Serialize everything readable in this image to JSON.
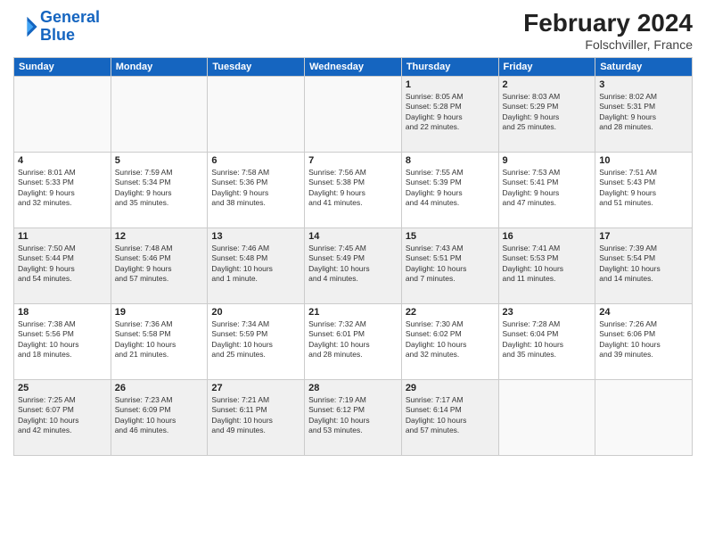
{
  "logo": {
    "line1": "General",
    "line2": "Blue"
  },
  "title": {
    "month_year": "February 2024",
    "location": "Folschviller, France"
  },
  "weekdays": [
    "Sunday",
    "Monday",
    "Tuesday",
    "Wednesday",
    "Thursday",
    "Friday",
    "Saturday"
  ],
  "weeks": [
    [
      {
        "day": "",
        "info": ""
      },
      {
        "day": "",
        "info": ""
      },
      {
        "day": "",
        "info": ""
      },
      {
        "day": "",
        "info": ""
      },
      {
        "day": "1",
        "info": "Sunrise: 8:05 AM\nSunset: 5:28 PM\nDaylight: 9 hours\nand 22 minutes."
      },
      {
        "day": "2",
        "info": "Sunrise: 8:03 AM\nSunset: 5:29 PM\nDaylight: 9 hours\nand 25 minutes."
      },
      {
        "day": "3",
        "info": "Sunrise: 8:02 AM\nSunset: 5:31 PM\nDaylight: 9 hours\nand 28 minutes."
      }
    ],
    [
      {
        "day": "4",
        "info": "Sunrise: 8:01 AM\nSunset: 5:33 PM\nDaylight: 9 hours\nand 32 minutes."
      },
      {
        "day": "5",
        "info": "Sunrise: 7:59 AM\nSunset: 5:34 PM\nDaylight: 9 hours\nand 35 minutes."
      },
      {
        "day": "6",
        "info": "Sunrise: 7:58 AM\nSunset: 5:36 PM\nDaylight: 9 hours\nand 38 minutes."
      },
      {
        "day": "7",
        "info": "Sunrise: 7:56 AM\nSunset: 5:38 PM\nDaylight: 9 hours\nand 41 minutes."
      },
      {
        "day": "8",
        "info": "Sunrise: 7:55 AM\nSunset: 5:39 PM\nDaylight: 9 hours\nand 44 minutes."
      },
      {
        "day": "9",
        "info": "Sunrise: 7:53 AM\nSunset: 5:41 PM\nDaylight: 9 hours\nand 47 minutes."
      },
      {
        "day": "10",
        "info": "Sunrise: 7:51 AM\nSunset: 5:43 PM\nDaylight: 9 hours\nand 51 minutes."
      }
    ],
    [
      {
        "day": "11",
        "info": "Sunrise: 7:50 AM\nSunset: 5:44 PM\nDaylight: 9 hours\nand 54 minutes."
      },
      {
        "day": "12",
        "info": "Sunrise: 7:48 AM\nSunset: 5:46 PM\nDaylight: 9 hours\nand 57 minutes."
      },
      {
        "day": "13",
        "info": "Sunrise: 7:46 AM\nSunset: 5:48 PM\nDaylight: 10 hours\nand 1 minute."
      },
      {
        "day": "14",
        "info": "Sunrise: 7:45 AM\nSunset: 5:49 PM\nDaylight: 10 hours\nand 4 minutes."
      },
      {
        "day": "15",
        "info": "Sunrise: 7:43 AM\nSunset: 5:51 PM\nDaylight: 10 hours\nand 7 minutes."
      },
      {
        "day": "16",
        "info": "Sunrise: 7:41 AM\nSunset: 5:53 PM\nDaylight: 10 hours\nand 11 minutes."
      },
      {
        "day": "17",
        "info": "Sunrise: 7:39 AM\nSunset: 5:54 PM\nDaylight: 10 hours\nand 14 minutes."
      }
    ],
    [
      {
        "day": "18",
        "info": "Sunrise: 7:38 AM\nSunset: 5:56 PM\nDaylight: 10 hours\nand 18 minutes."
      },
      {
        "day": "19",
        "info": "Sunrise: 7:36 AM\nSunset: 5:58 PM\nDaylight: 10 hours\nand 21 minutes."
      },
      {
        "day": "20",
        "info": "Sunrise: 7:34 AM\nSunset: 5:59 PM\nDaylight: 10 hours\nand 25 minutes."
      },
      {
        "day": "21",
        "info": "Sunrise: 7:32 AM\nSunset: 6:01 PM\nDaylight: 10 hours\nand 28 minutes."
      },
      {
        "day": "22",
        "info": "Sunrise: 7:30 AM\nSunset: 6:02 PM\nDaylight: 10 hours\nand 32 minutes."
      },
      {
        "day": "23",
        "info": "Sunrise: 7:28 AM\nSunset: 6:04 PM\nDaylight: 10 hours\nand 35 minutes."
      },
      {
        "day": "24",
        "info": "Sunrise: 7:26 AM\nSunset: 6:06 PM\nDaylight: 10 hours\nand 39 minutes."
      }
    ],
    [
      {
        "day": "25",
        "info": "Sunrise: 7:25 AM\nSunset: 6:07 PM\nDaylight: 10 hours\nand 42 minutes."
      },
      {
        "day": "26",
        "info": "Sunrise: 7:23 AM\nSunset: 6:09 PM\nDaylight: 10 hours\nand 46 minutes."
      },
      {
        "day": "27",
        "info": "Sunrise: 7:21 AM\nSunset: 6:11 PM\nDaylight: 10 hours\nand 49 minutes."
      },
      {
        "day": "28",
        "info": "Sunrise: 7:19 AM\nSunset: 6:12 PM\nDaylight: 10 hours\nand 53 minutes."
      },
      {
        "day": "29",
        "info": "Sunrise: 7:17 AM\nSunset: 6:14 PM\nDaylight: 10 hours\nand 57 minutes."
      },
      {
        "day": "",
        "info": ""
      },
      {
        "day": "",
        "info": ""
      }
    ]
  ]
}
